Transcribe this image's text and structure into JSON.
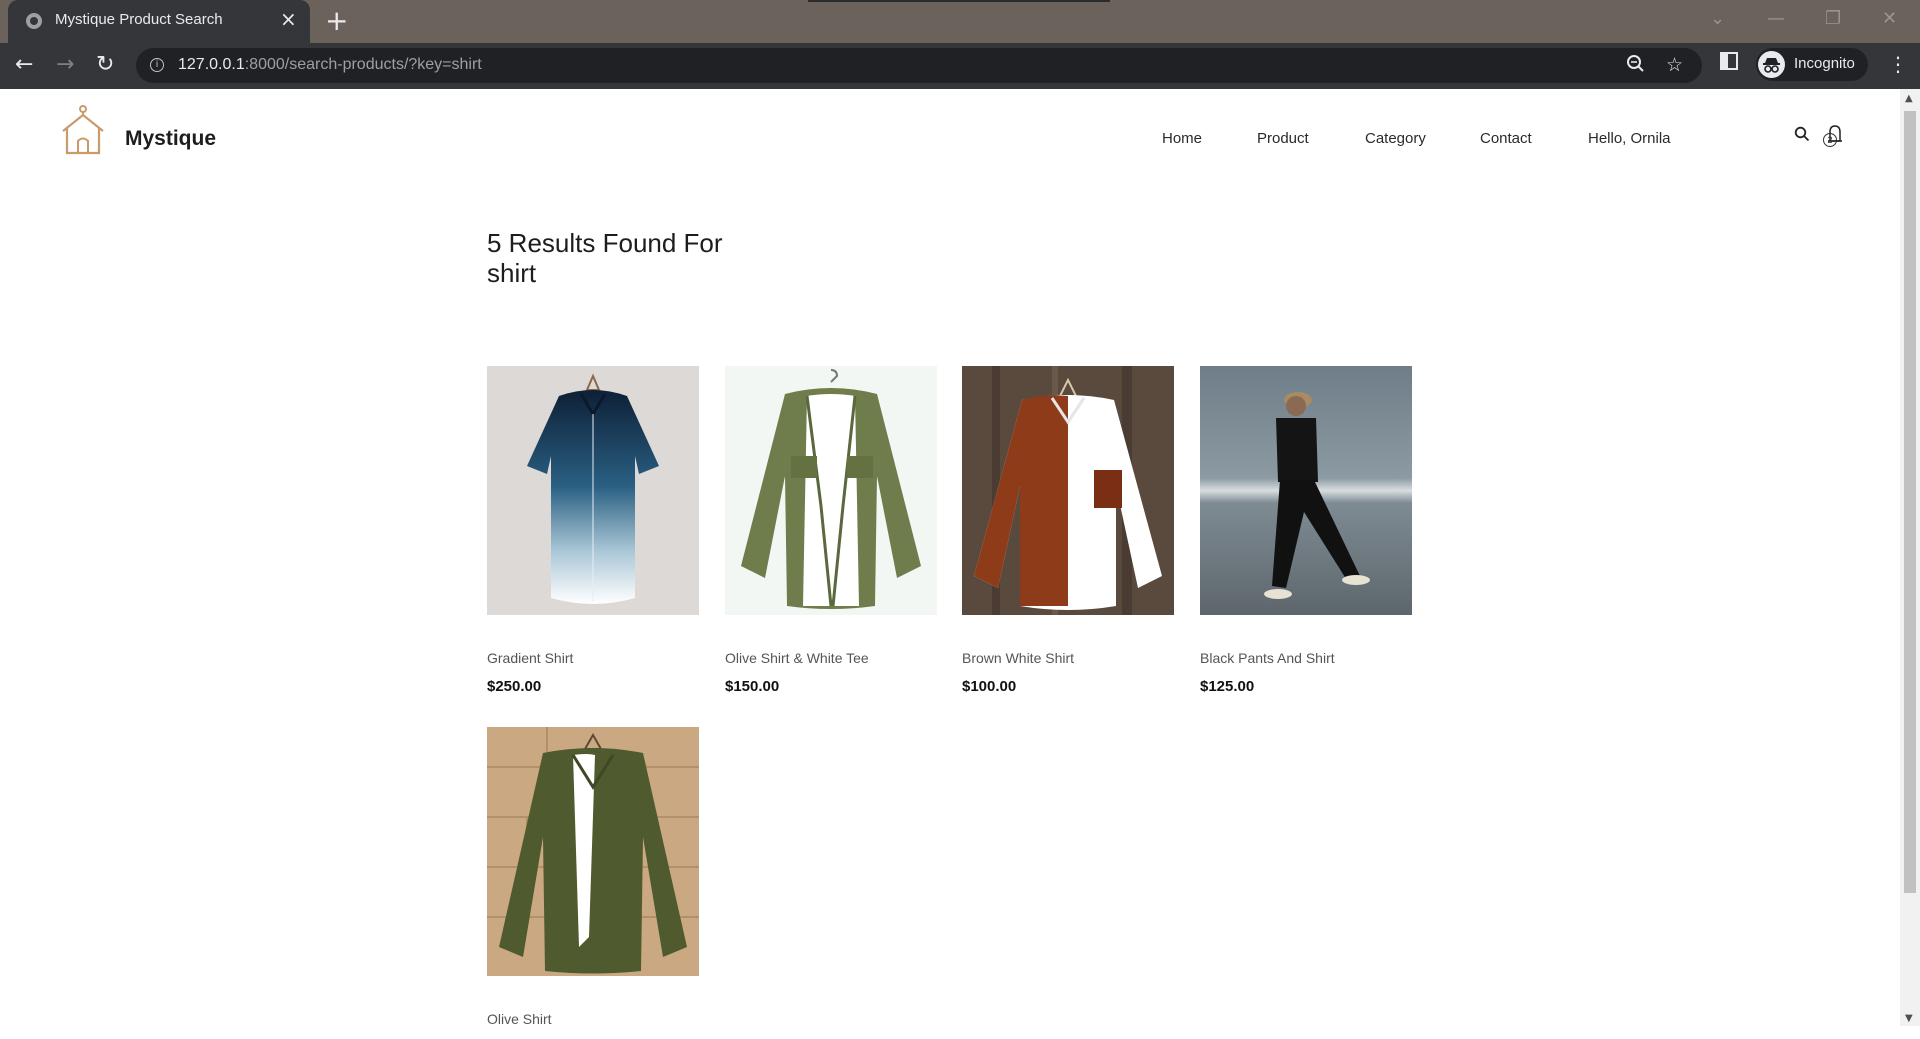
{
  "browser": {
    "tab_title": "Mystique Product Search",
    "url_host": "127.0.0.1",
    "url_rest": ":8000/search-products/?key=shirt",
    "profile_label": "Incognito"
  },
  "site": {
    "brand": "Mystique",
    "nav": [
      "Home",
      "Product",
      "Category",
      "Contact",
      "Hello, Ornila"
    ],
    "cart_count": "2"
  },
  "results": {
    "title_line1": "5 Results Found For",
    "title_line2": "shirt"
  },
  "products": [
    {
      "name": "Gradient Shirt",
      "price": "$250.00"
    },
    {
      "name": "Olive Shirt & White Tee",
      "price": "$150.00"
    },
    {
      "name": "Brown White Shirt",
      "price": "$100.00"
    },
    {
      "name": "Black Pants And Shirt",
      "price": "$125.00"
    },
    {
      "name": "Olive Shirt",
      "price": ""
    }
  ],
  "colors": {
    "accent": "#c99a6a",
    "chrome_dark": "#35363a",
    "tabstrip": "#6b625c"
  }
}
